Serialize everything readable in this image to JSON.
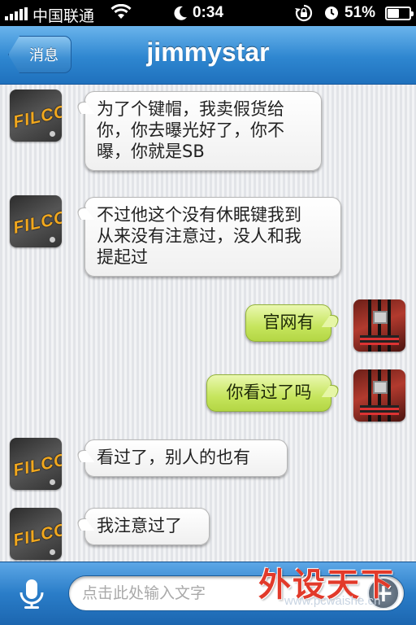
{
  "status_bar": {
    "carrier": "中国联通",
    "time": "0:34",
    "battery": "51%",
    "battery_level": 0.51,
    "icons": [
      "signal-icon",
      "wifi-icon",
      "moon-icon",
      "rotation-lock-icon",
      "alarm-icon",
      "battery-icon"
    ]
  },
  "nav": {
    "back_label": "消息",
    "title": "jimmystar"
  },
  "messages": [
    {
      "side": "in",
      "avatar": "filco-logo-avatar",
      "lines": [
        "为了个键帽，我卖假货给",
        "你，你去曝光好了，你不",
        "曝，你就是SB"
      ]
    },
    {
      "side": "in",
      "avatar": "filco-logo-avatar",
      "lines": [
        "不过他这个没有休眠键我到",
        "从来没有注意过，没人和我",
        "提起过"
      ]
    },
    {
      "side": "out",
      "avatar": "motherboard-avatar",
      "lines": [
        "官网有"
      ]
    },
    {
      "side": "out",
      "avatar": "motherboard-avatar",
      "lines": [
        "你看过了吗"
      ]
    },
    {
      "side": "in",
      "avatar": "filco-logo-avatar",
      "lines": [
        "看过了，别人的也有"
      ]
    },
    {
      "side": "in",
      "avatar": "filco-logo-avatar",
      "lines": [
        "我注意过了"
      ]
    }
  ],
  "avatar_logo_text": "FILCO",
  "input": {
    "placeholder": "点击此处输入文字",
    "mic_icon": "microphone-icon",
    "plus_icon": "plus-icon"
  },
  "watermark": {
    "logo": "外设天下",
    "url": "www.pcwaishe.cn"
  },
  "colors": {
    "nav_blue": "#2e86d0",
    "incoming_bubble": "#ffffff",
    "outgoing_bubble": "#c6e55d"
  }
}
